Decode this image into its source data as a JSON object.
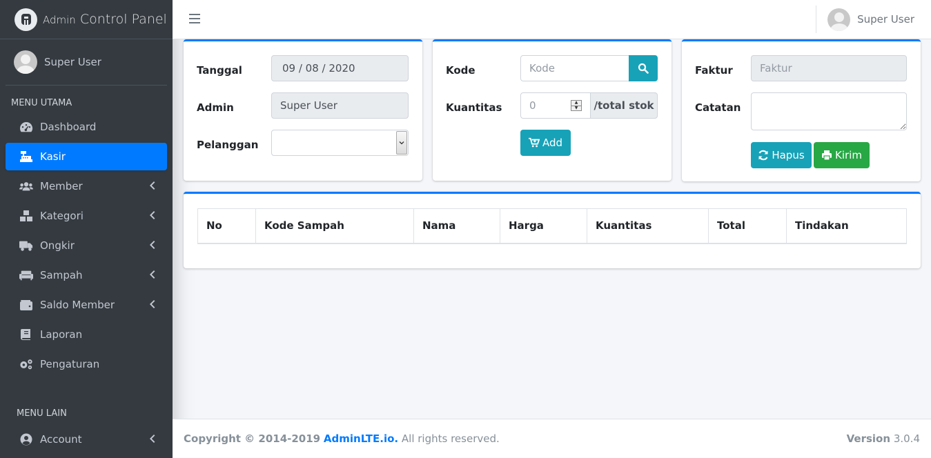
{
  "brand": {
    "small": "Admin",
    "large": "Control Panel"
  },
  "sidebar": {
    "user_name": "Super User",
    "header_main": "MENU UTAMA",
    "header_other": "MENU LAIN",
    "items": [
      {
        "label": "Dashboard",
        "icon": "tachometer-icon"
      },
      {
        "label": "Kasir",
        "icon": "cash-register-icon"
      },
      {
        "label": "Member",
        "icon": "users-icon"
      },
      {
        "label": "Kategori",
        "icon": "cubes-icon"
      },
      {
        "label": "Ongkir",
        "icon": "truck-icon"
      },
      {
        "label": "Sampah",
        "icon": "couch-icon"
      },
      {
        "label": "Saldo Member",
        "icon": "wallet-icon"
      },
      {
        "label": "Laporan",
        "icon": "book-icon"
      },
      {
        "label": "Pengaturan",
        "icon": "cogs-icon"
      },
      {
        "label": "Account",
        "icon": "user-circle-icon"
      }
    ],
    "accent": "#007bff"
  },
  "topbar": {
    "user_name": "Super User"
  },
  "form_left": {
    "tanggal_label": "Tanggal",
    "tanggal_value": "09 / 08 / 2020",
    "admin_label": "Admin",
    "admin_value": "Super User",
    "pelanggan_label": "Pelanggan",
    "pelanggan_value": ""
  },
  "form_middle": {
    "kode_label": "Kode",
    "kode_placeholder": "Kode",
    "kuantitas_label": "Kuantitas",
    "kuantitas_value": "0",
    "stok_addon": "/total stok",
    "add_button": "Add"
  },
  "form_right": {
    "faktur_label": "Faktur",
    "faktur_placeholder": "Faktur",
    "catatan_label": "Catatan",
    "hapus_button": "Hapus",
    "kirim_button": "Kirim"
  },
  "table": {
    "headers": [
      "No",
      "Kode Sampah",
      "Nama",
      "Harga",
      "Kuantitas",
      "Total",
      "Tindakan"
    ]
  },
  "footer": {
    "copyright": "Copyright © 2014-2019",
    "link": "AdminLTE.io.",
    "rights": "All rights reserved.",
    "version_label": "Version",
    "version_value": "3.0.4"
  }
}
